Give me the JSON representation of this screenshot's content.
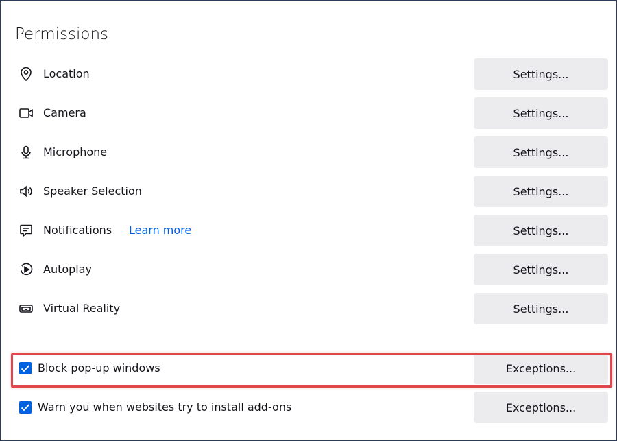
{
  "section": {
    "title": "Permissions"
  },
  "permissions": [
    {
      "key": "location",
      "icon": "location-pin-icon",
      "label": "Location",
      "button": "Settings..."
    },
    {
      "key": "camera",
      "icon": "camera-icon",
      "label": "Camera",
      "button": "Settings..."
    },
    {
      "key": "microphone",
      "icon": "microphone-icon",
      "label": "Microphone",
      "button": "Settings..."
    },
    {
      "key": "speaker",
      "icon": "speaker-icon",
      "label": "Speaker Selection",
      "button": "Settings..."
    },
    {
      "key": "notifications",
      "icon": "notification-icon",
      "label": "Notifications",
      "link": "Learn more",
      "button": "Settings..."
    },
    {
      "key": "autoplay",
      "icon": "autoplay-icon",
      "label": "Autoplay",
      "button": "Settings..."
    },
    {
      "key": "vr",
      "icon": "vr-headset-icon",
      "label": "Virtual Reality",
      "button": "Settings..."
    }
  ],
  "checkboxes": [
    {
      "key": "block_popups",
      "label": "Block pop-up windows",
      "checked": true,
      "button": "Exceptions..."
    },
    {
      "key": "warn_addons",
      "label": "Warn you when websites try to install add-ons",
      "checked": true,
      "button": "Exceptions..."
    }
  ],
  "colors": {
    "accent": "#0061e0",
    "button_bg": "#ececef",
    "highlight": "#e0474d",
    "frame": "#2c3d5e"
  }
}
